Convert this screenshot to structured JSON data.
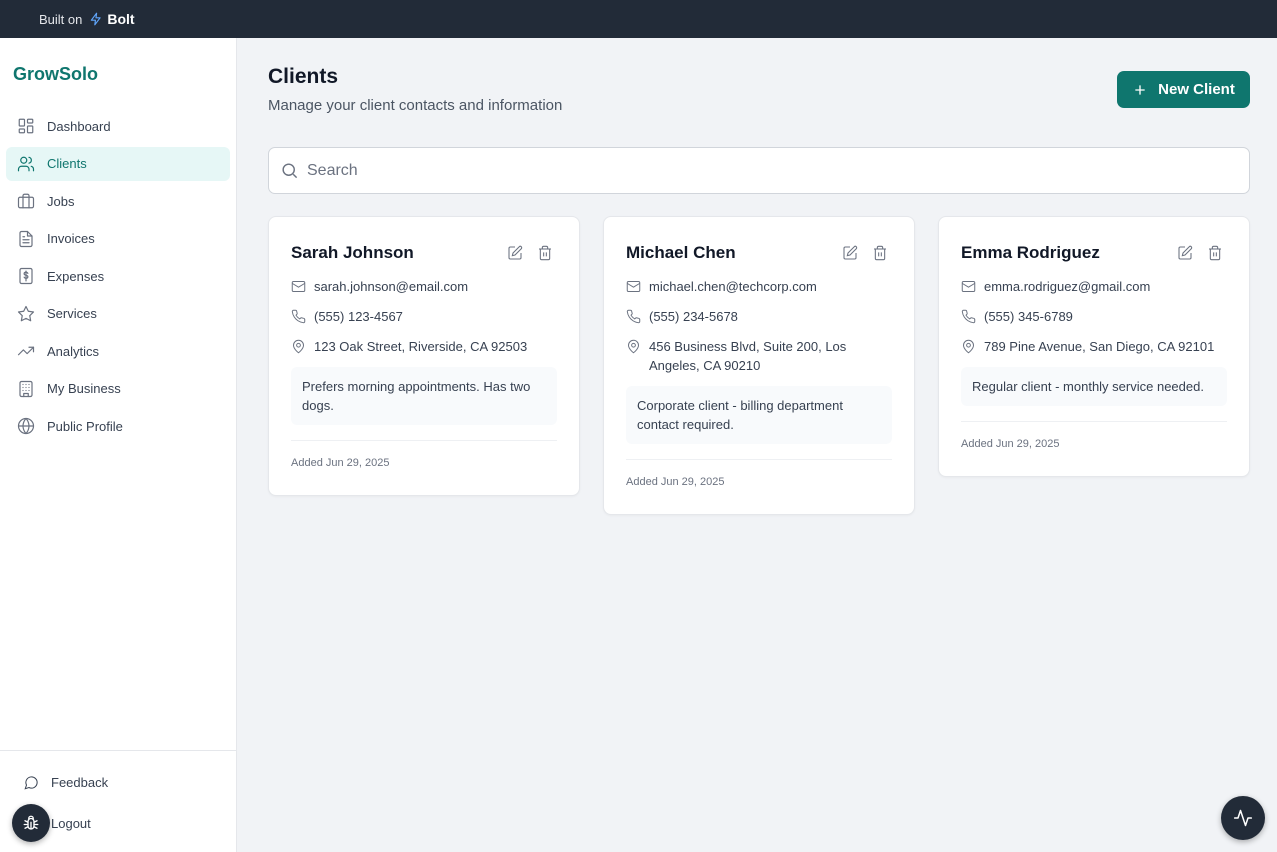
{
  "topbar": {
    "built_on": "Built on",
    "brand": "Bolt"
  },
  "sidebar": {
    "brand": "GrowSolo",
    "items": [
      {
        "label": "Dashboard",
        "icon": "dashboard-icon"
      },
      {
        "label": "Clients",
        "icon": "users-icon",
        "active": true
      },
      {
        "label": "Jobs",
        "icon": "briefcase-icon"
      },
      {
        "label": "Invoices",
        "icon": "file-text-icon"
      },
      {
        "label": "Expenses",
        "icon": "dollar-receipt-icon"
      },
      {
        "label": "Services",
        "icon": "star-icon"
      },
      {
        "label": "Analytics",
        "icon": "trending-up-icon"
      },
      {
        "label": "My Business",
        "icon": "building-icon"
      },
      {
        "label": "Public Profile",
        "icon": "globe-icon"
      }
    ],
    "feedback": "Feedback",
    "logout": "Logout"
  },
  "main": {
    "title": "Clients",
    "subtitle": "Manage your client contacts and information",
    "new_button": "New Client",
    "search_placeholder": "Search",
    "clients": [
      {
        "name": "Sarah Johnson",
        "email": "sarah.johnson@email.com",
        "phone": "(555) 123-4567",
        "address": "123 Oak Street, Riverside, CA 92503",
        "note": "Prefers morning appointments. Has two dogs.",
        "added": "Added Jun 29, 2025"
      },
      {
        "name": "Michael Chen",
        "email": "michael.chen@techcorp.com",
        "phone": "(555) 234-5678",
        "address": "456 Business Blvd, Suite 200, Los Angeles, CA 90210",
        "note": "Corporate client - billing department contact required.",
        "added": "Added Jun 29, 2025"
      },
      {
        "name": "Emma Rodriguez",
        "email": "emma.rodriguez@gmail.com",
        "phone": "(555) 345-6789",
        "address": "789 Pine Avenue, San Diego, CA 92101",
        "note": "Regular client - monthly service needed.",
        "added": "Added Jun 29, 2025"
      }
    ]
  },
  "colors": {
    "accent": "#0f766e",
    "topbar": "#222b38",
    "active_bg": "#e6f7f6"
  }
}
